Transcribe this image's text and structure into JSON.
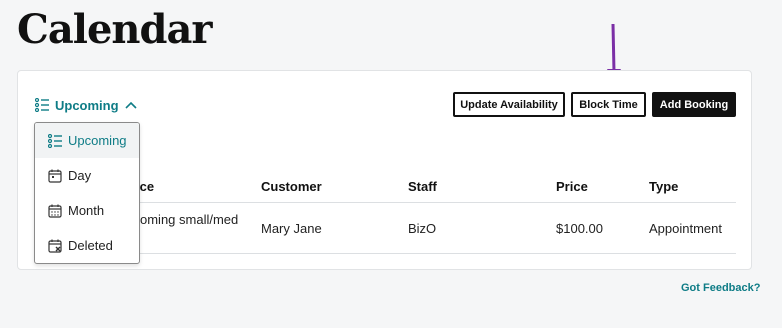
{
  "page": {
    "title": "Calendar"
  },
  "view_toggle": {
    "label": "Upcoming"
  },
  "buttons": {
    "update_availability": "Update Availability",
    "block_time": "Block Time",
    "add_booking": "Add Booking"
  },
  "table": {
    "headers": [
      "ice",
      "Customer",
      "Staff",
      "Price",
      "Type"
    ],
    "row": {
      "service_line1": "oming small/med",
      "service_line2": "",
      "customer": "Mary Jane",
      "staff": "BizO",
      "price": "$100.00",
      "type": "Appointment"
    }
  },
  "dropdown": {
    "items": [
      "Upcoming",
      "Day",
      "Month",
      "Deleted"
    ]
  },
  "footer": {
    "feedback_link": "Got Feedback?"
  },
  "colors": {
    "accent": "#0e7c86",
    "annotation_arrow": "#7b2fa6",
    "primary_button": "#111111"
  }
}
